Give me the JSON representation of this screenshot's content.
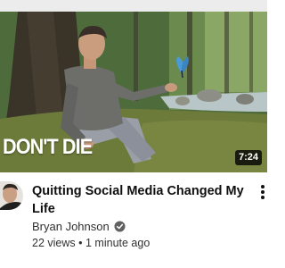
{
  "thumbnail": {
    "overlay_text": "DON'T DIE",
    "duration": "7:24",
    "butterfly_color": "#4a9ad8",
    "icons": [
      "person-figure",
      "butterfly-icon"
    ]
  },
  "video": {
    "title": "Quitting Social Media Changed My Life",
    "channel": "Bryan Johnson",
    "verified": true,
    "views": "22 views",
    "separator": "•",
    "age": "1 minute ago"
  },
  "colors": {
    "title": "#0f0f0f",
    "meta": "#303030",
    "verified_badge": "#606060",
    "top_strip": "#ececec"
  }
}
